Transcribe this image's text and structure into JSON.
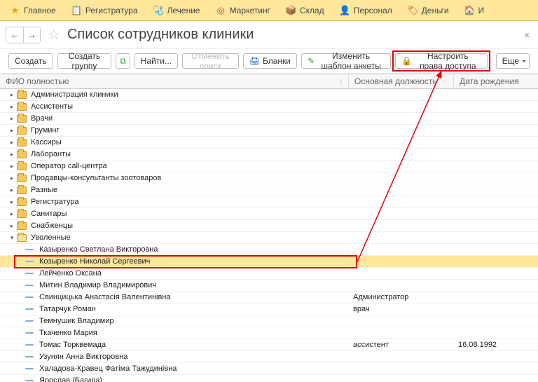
{
  "top_tabs": [
    {
      "label": "Главное",
      "icon": "★",
      "color": "#e6a500"
    },
    {
      "label": "Регистратура",
      "icon": "📋",
      "color": "#2b8"
    },
    {
      "label": "Лечение",
      "icon": "🩺",
      "color": "#d66"
    },
    {
      "label": "Маркетинг",
      "icon": "◎",
      "color": "#c44"
    },
    {
      "label": "Склад",
      "icon": "📦",
      "color": "#b80"
    },
    {
      "label": "Персонал",
      "icon": "👤",
      "color": "#69c"
    },
    {
      "label": "Деньги",
      "icon": "🏷",
      "color": "#c33"
    },
    {
      "label": "И",
      "icon": "🏠",
      "color": "#e6a500"
    }
  ],
  "nav": {
    "back": "←",
    "fwd": "→"
  },
  "page_title": "Список сотрудников клиники",
  "toolbar": {
    "create": "Создать",
    "create_group": "Создать группу",
    "find": "Найти...",
    "cancel_search": "Отменить поиск",
    "blanks": "Бланки",
    "edit_template": "Изменить шаблон анкеты",
    "access_rights": "Настроить права доступа",
    "more": "Еще"
  },
  "columns": {
    "name": "ФИО полностью",
    "position": "Основная должность",
    "birth": "Дата рождения"
  },
  "folders": [
    {
      "label": "Администрация клиники",
      "expanded": false
    },
    {
      "label": "Ассистенты",
      "expanded": false
    },
    {
      "label": "Врачи",
      "expanded": false
    },
    {
      "label": "Груминг",
      "expanded": false
    },
    {
      "label": "Кассиры",
      "expanded": false
    },
    {
      "label": "Лаборанты",
      "expanded": false
    },
    {
      "label": "Оператор call-центра",
      "expanded": false
    },
    {
      "label": "Продавцы-консультанты зоотоваров",
      "expanded": false
    },
    {
      "label": "Разные",
      "expanded": false
    },
    {
      "label": "Регистратура",
      "expanded": false
    },
    {
      "label": "Санитары",
      "expanded": false
    },
    {
      "label": "Снабженцы",
      "expanded": false
    }
  ],
  "open_folder": {
    "label": "Уволенные"
  },
  "people": [
    {
      "name": "Казыренко Светлана Викторовна",
      "pos": "",
      "date": ""
    },
    {
      "name": "Козыренко Николай Сергеевич",
      "pos": "",
      "date": "",
      "selected": true
    },
    {
      "name": "Лейченко Оксана",
      "pos": "",
      "date": ""
    },
    {
      "name": "Митин Владимир Владимирович",
      "pos": "",
      "date": ""
    },
    {
      "name": "Свинцицька Анастасія Валентинівна",
      "pos": "Администратор",
      "date": ""
    },
    {
      "name": "Татарчук Роман",
      "pos": "врач",
      "date": ""
    },
    {
      "name": "Темнушик Владимир",
      "pos": "",
      "date": ""
    },
    {
      "name": "Ткаченко Мария",
      "pos": "",
      "date": ""
    },
    {
      "name": "Томас Торквемада",
      "pos": "ассистент",
      "date": "16.08.1992"
    },
    {
      "name": "Узунян Анна Викторовна",
      "pos": "",
      "date": ""
    },
    {
      "name": "Халадова-Кравец Фатіма Тажудинівна",
      "pos": "",
      "date": ""
    },
    {
      "name": "Ярослав (Багира)",
      "pos": "",
      "date": ""
    }
  ]
}
